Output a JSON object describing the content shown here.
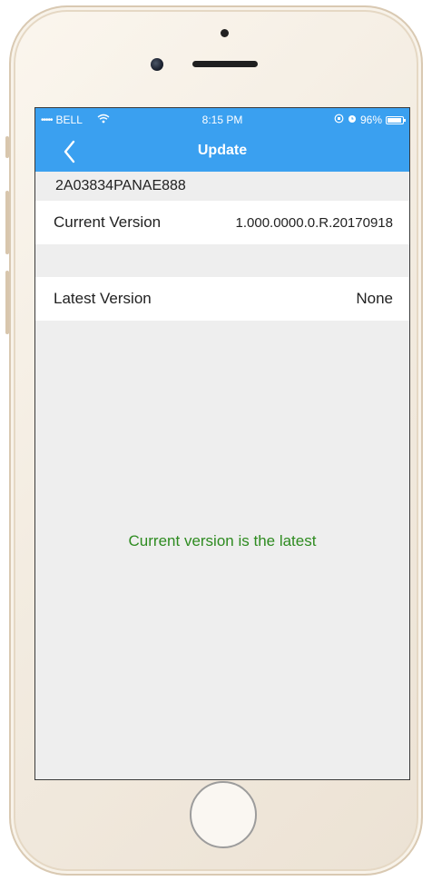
{
  "status_bar": {
    "carrier": "BELL",
    "signal_dots": "•••••",
    "time": "8:15 PM",
    "battery_percent": "96%",
    "battery_level": 0.96
  },
  "nav": {
    "title": "Update",
    "back_icon": "chevron-left-icon"
  },
  "device": {
    "serial": "2A03834PANAE888"
  },
  "rows": {
    "current_version_label": "Current Version",
    "current_version_value": "1.000.0000.0.R.20170918",
    "latest_version_label": "Latest Version",
    "latest_version_value": "None"
  },
  "message": {
    "text": "Current version is the latest",
    "color": "#2e8b20"
  },
  "colors": {
    "accent": "#3aa0f0",
    "background": "#eeeeee"
  }
}
